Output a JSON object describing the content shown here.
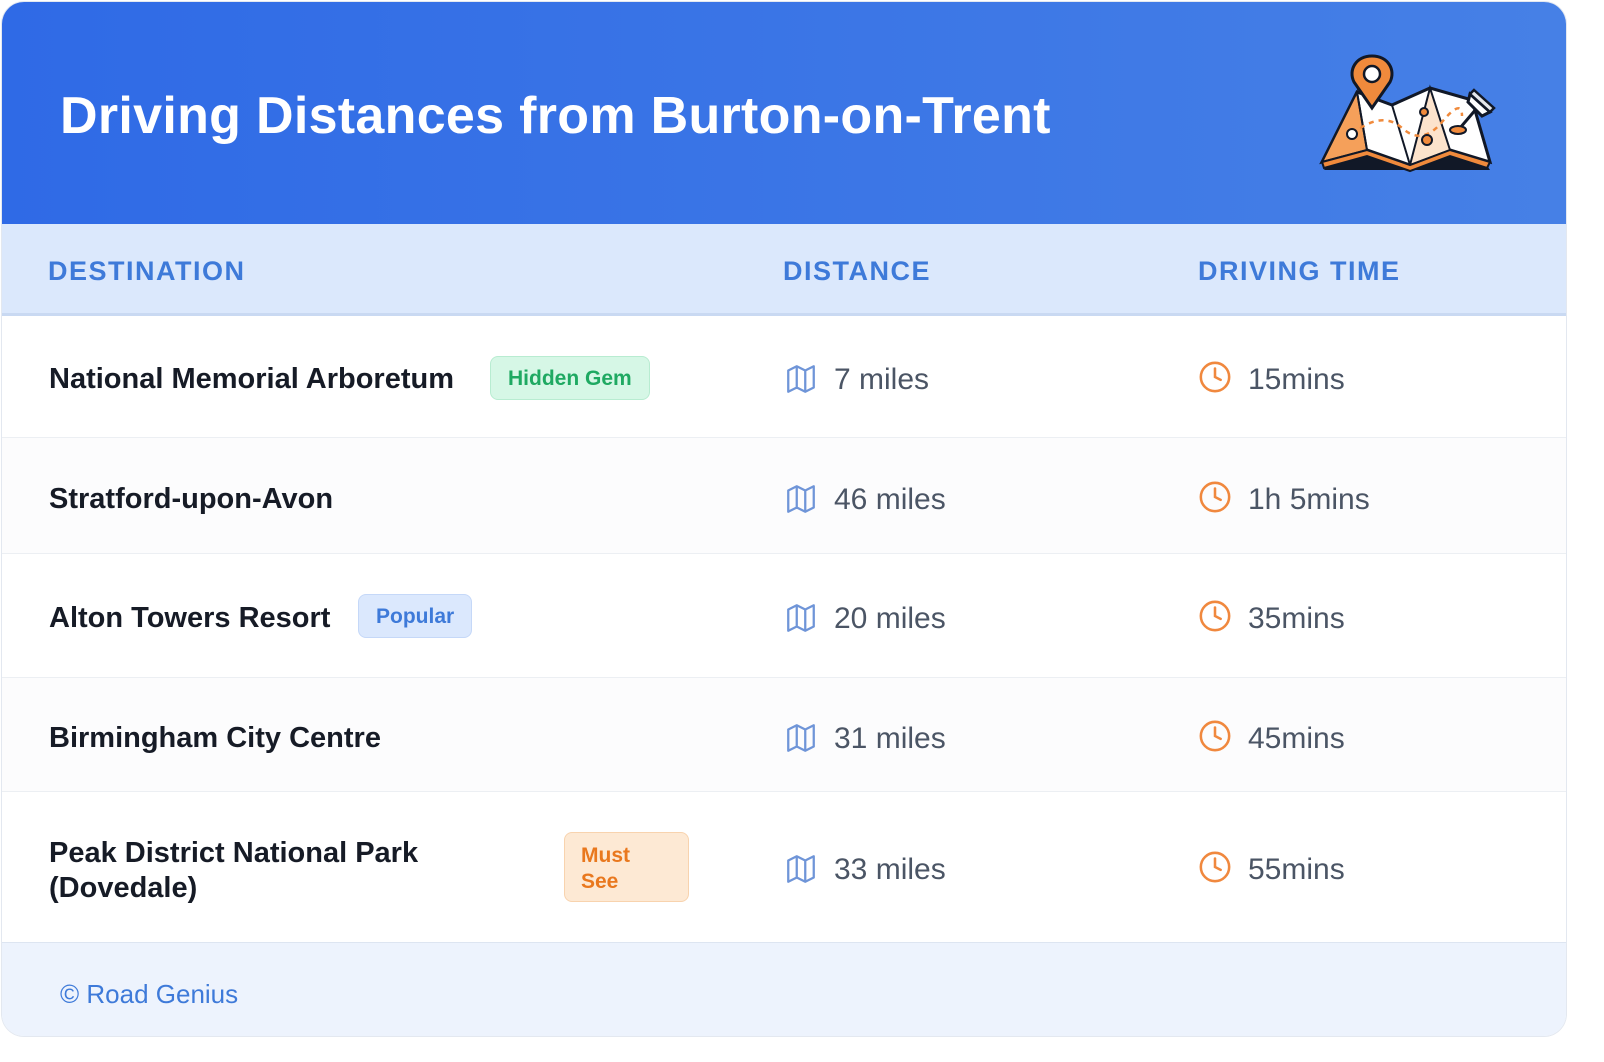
{
  "header": {
    "title": "Driving Distances from Burton-on-Trent",
    "illustration_icon": "map-with-pins-icon"
  },
  "table": {
    "columns": [
      "DESTINATION",
      "DISTANCE",
      "DRIVING TIME"
    ],
    "rows": [
      {
        "destination": "National Memorial Arboretum",
        "badge": "Hidden Gem",
        "badge_color": "green",
        "distance": "7 miles",
        "time": "15mins"
      },
      {
        "destination": "Stratford-upon-Avon",
        "badge": "",
        "badge_color": "",
        "distance": "46 miles",
        "time": "1h 5mins"
      },
      {
        "destination": "Alton Towers Resort",
        "badge": "Popular",
        "badge_color": "blue",
        "distance": "20 miles",
        "time": "35mins"
      },
      {
        "destination": "Birmingham City Centre",
        "badge": "",
        "badge_color": "",
        "distance": "31 miles",
        "time": "45mins"
      },
      {
        "destination": "Peak District National Park (Dovedale)",
        "badge": "Must See",
        "badge_color": "orange",
        "distance": "33 miles",
        "time": "55mins"
      }
    ],
    "distance_icon": "map-icon",
    "time_icon": "clock-icon"
  },
  "footer": {
    "text": "© Road Genius"
  },
  "colors": {
    "header_gradient_start": "#2f6ae6",
    "header_gradient_end": "#4680e6",
    "accent_blue": "#3e7ad9",
    "clock_orange": "#f0883e",
    "badge_green": "#1fa962",
    "badge_orange": "#e9781e"
  }
}
